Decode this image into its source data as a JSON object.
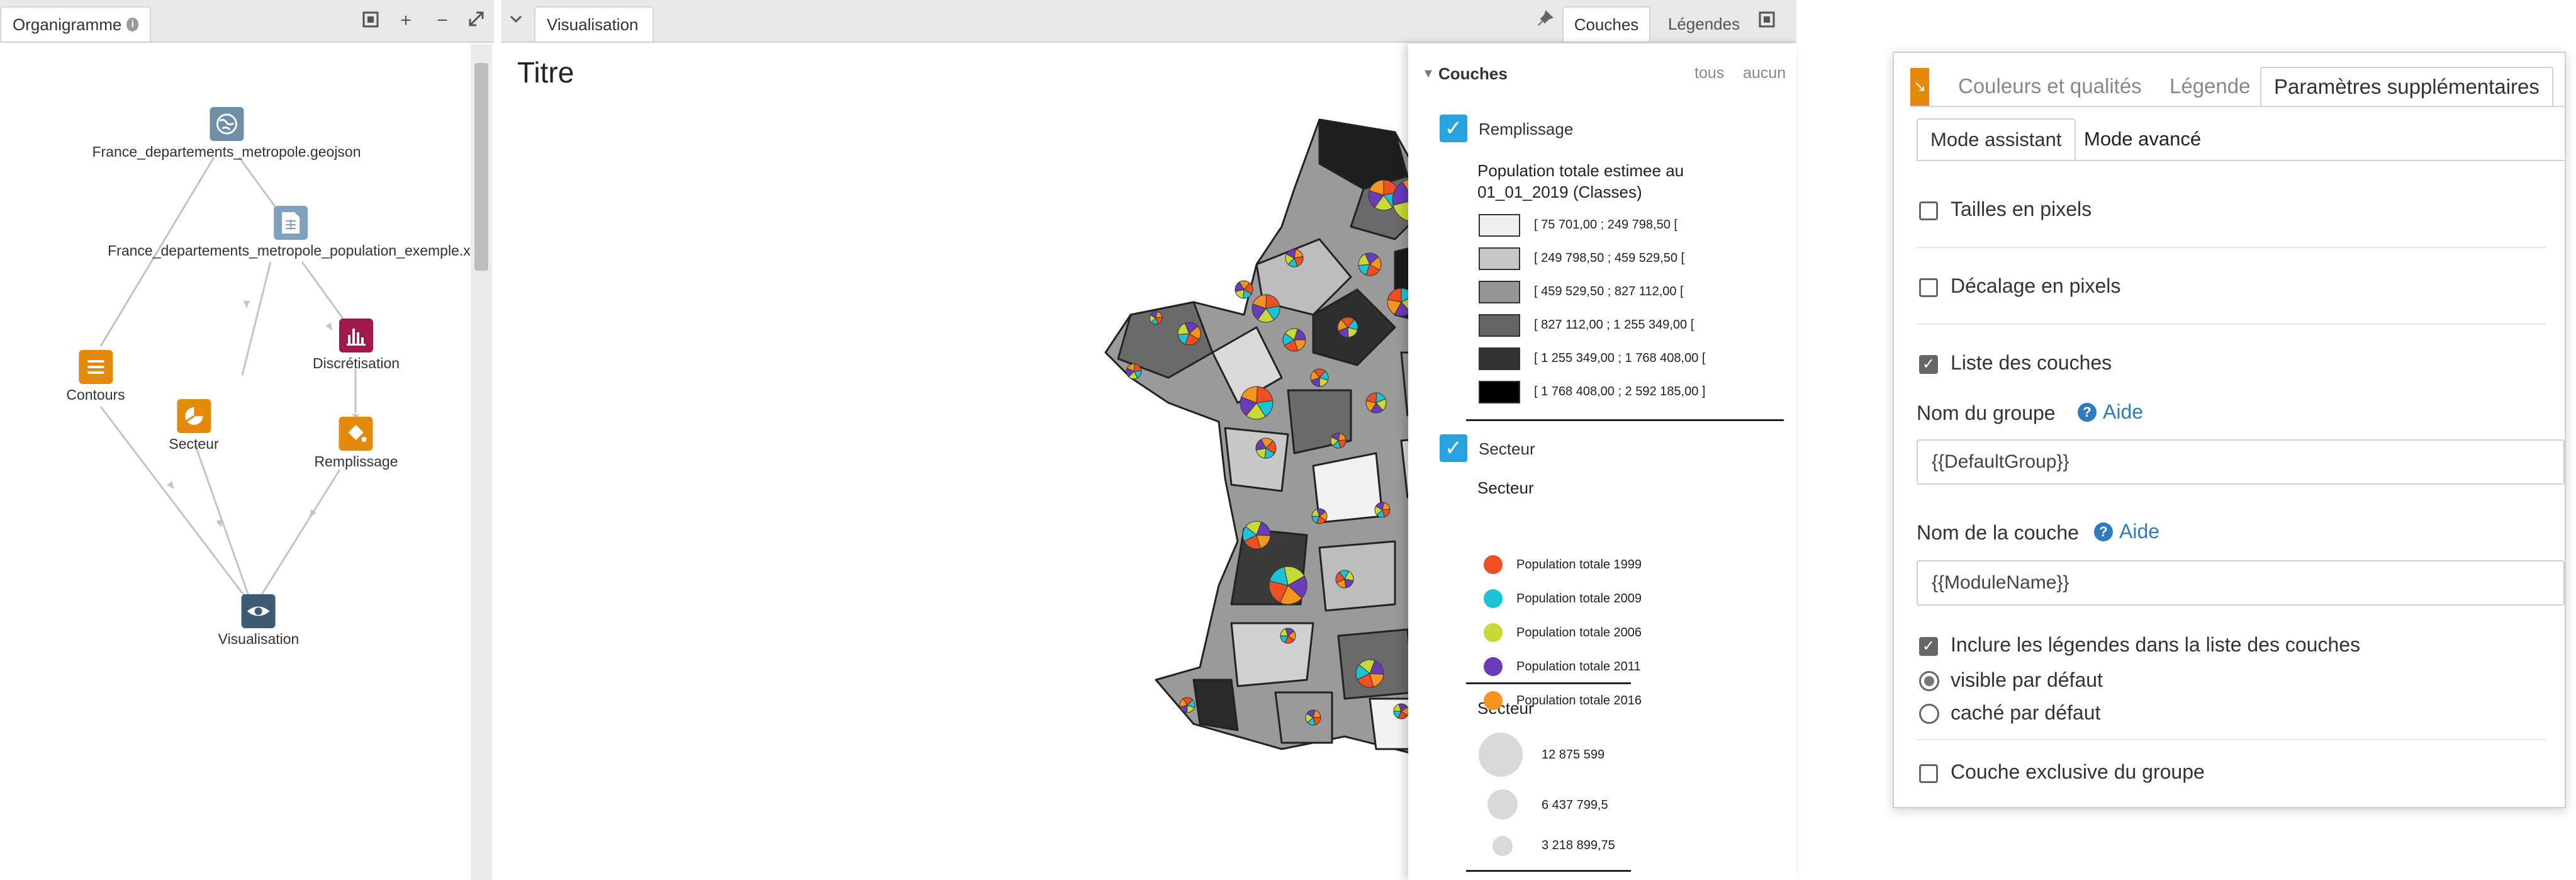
{
  "organigramme": {
    "tab_label": "Organigramme",
    "info_icon": "info-icon",
    "toolbar": [
      "fit-icon",
      "zoom-in-icon",
      "zoom-out-icon",
      "expand-icon"
    ],
    "nodes": [
      {
        "label": "France_departements_metropole.geojson",
        "icon": "globe-icon",
        "color": "#6e8fa6"
      },
      {
        "label": "France_departements_metropole_population_exemple.xl",
        "icon": "spreadsheet-icon",
        "color": "#7fa1bb"
      },
      {
        "label": "Discrétisation",
        "icon": "bar-chart-icon",
        "color": "#a3184a"
      },
      {
        "label": "Contours",
        "icon": "list-icon",
        "color": "#e48a0a"
      },
      {
        "label": "Secteur",
        "icon": "pie-icon",
        "color": "#e48a0a"
      },
      {
        "label": "Remplissage",
        "icon": "paint-bucket-icon",
        "color": "#e48a0a"
      },
      {
        "label": "Visualisation",
        "icon": "eye-icon",
        "color": "#3d5a73"
      }
    ]
  },
  "visualisation": {
    "tab_label": "Visualisation",
    "right_tabs": {
      "couches": "Couches",
      "legendes": "Légendes"
    },
    "map_title": "Titre"
  },
  "legend": {
    "header": "Couches",
    "all_label": "tous",
    "none_label": "aucun",
    "layer1": {
      "name": "Remplissage",
      "title_line1": "Population totale estimee au",
      "title_line2": "01_01_2019 (Classes)",
      "classes": [
        {
          "label": "[ 75 701,00 ; 249 798,50 [",
          "color": "#f0f0f0"
        },
        {
          "label": "[ 249 798,50 ; 459 529,50 [",
          "color": "#c8c8c8"
        },
        {
          "label": "[ 459 529,50 ; 827 112,00 [",
          "color": "#969696"
        },
        {
          "label": "[ 827 112,00 ; 1 255 349,00 [",
          "color": "#646464"
        },
        {
          "label": "[ 1 255 349,00 ; 1 768 408,00 [",
          "color": "#323232"
        },
        {
          "label": "[ 1 768 408,00 ; 2 592 185,00 ]",
          "color": "#000000"
        }
      ]
    },
    "layer2": {
      "name": "Secteur",
      "subtitle": "Secteur",
      "series": [
        {
          "label": "Population totale 1999",
          "color": "#f04e23"
        },
        {
          "label": "Population totale 2009",
          "color": "#1cc3d6"
        },
        {
          "label": "Population totale 2006",
          "color": "#c8d837"
        },
        {
          "label": "Population totale 2011",
          "color": "#6a3cb8"
        },
        {
          "label": "Population totale 2016",
          "color": "#f7941d"
        }
      ],
      "size_title": "Secteur",
      "sizes": [
        "12 875 599",
        "6 437 799,5",
        "3 218 899,75"
      ]
    }
  },
  "params": {
    "tabs": [
      "Couleurs et qualités",
      "Légende",
      "Paramètres supplémentaires"
    ],
    "mode_tabs": [
      "Mode assistant",
      "Mode avancé"
    ],
    "tailles": {
      "label": "Tailles en pixels",
      "checked": false
    },
    "decalage": {
      "label": "Décalage en pixels",
      "checked": false
    },
    "liste": {
      "label": "Liste des couches",
      "checked": true
    },
    "group_name_label": "Nom du groupe",
    "help_label": "Aide",
    "group_name_value": "{{DefaultGroup}}",
    "layer_name_label": "Nom de la couche",
    "layer_name_value": "{{ModuleName}}",
    "inclure": {
      "label": "Inclure les légendes dans la liste des couches",
      "checked": true
    },
    "radio_visible": "visible par défaut",
    "radio_cache": "caché par défaut",
    "exclusive": {
      "label": "Couche exclusive du groupe",
      "checked": false
    }
  }
}
